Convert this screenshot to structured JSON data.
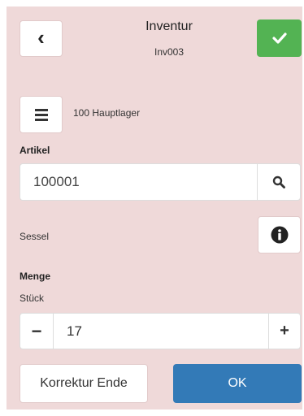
{
  "header": {
    "title": "Inventur",
    "subtitle": "Inv003",
    "back_icon": "chevron-left-icon",
    "confirm_icon": "check-icon",
    "confirm_color": "#53b353"
  },
  "warehouse": {
    "icon": "list-icon",
    "label": "100 Hauptlager"
  },
  "article": {
    "label": "Artikel",
    "value": "100001",
    "search_icon": "search-icon",
    "name": "Sessel",
    "info_icon": "info-icon"
  },
  "quantity": {
    "label": "Menge",
    "unit": "Stück",
    "minus": "−",
    "value": "17",
    "plus": "+"
  },
  "footer": {
    "correction_label": "Korrektur Ende",
    "ok_label": "OK",
    "ok_color": "#337ab7"
  },
  "colors": {
    "background": "#efd9d9"
  }
}
